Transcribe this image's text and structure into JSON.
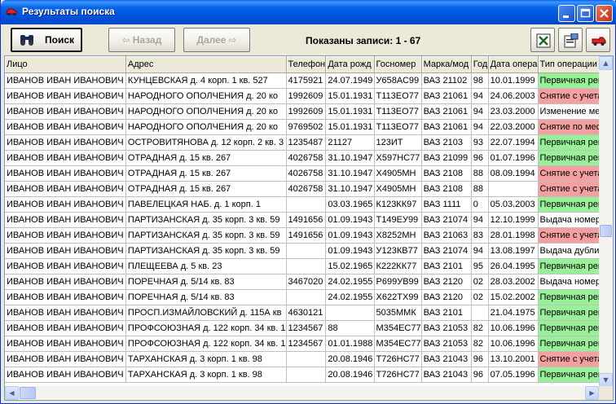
{
  "window": {
    "title": "Результаты поиска"
  },
  "toolbar": {
    "search_label": "Поиск",
    "back_label": "Назад",
    "next_label": "Далее",
    "records_text": "Показаны записи: 1 - 67"
  },
  "columns": [
    "Лицо",
    "Адрес",
    "Телефон",
    "Дата рожд",
    "Госномер",
    "Марка/мод",
    "Год",
    "Дата опера",
    "Тип операции"
  ],
  "rows": [
    {
      "c": [
        "ИВАНОВ ИВАН ИВАНОВИЧ",
        "КУНЦЕВСКАЯ д. 4 корп. 1 кв. 527",
        "4175921",
        "24.07.1949",
        "У658АС99",
        "ВАЗ 21102",
        "98",
        "10.01.1999",
        "Первичная реги"
      ],
      "op": "green"
    },
    {
      "c": [
        "ИВАНОВ ИВАН ИВАНОВИЧ",
        "НАРОДНОГО ОПОЛЧЕНИЯ д. 20 ко",
        "1992609",
        "15.01.1931",
        "Т113ЕО77",
        "ВАЗ 21061",
        "94",
        "24.06.2003",
        "Снятие с учета д"
      ],
      "op": "pink"
    },
    {
      "c": [
        "ИВАНОВ ИВАН ИВАНОВИЧ",
        "НАРОДНОГО ОПОЛЧЕНИЯ д. 20 ко",
        "1992609",
        "15.01.1931",
        "Т113ЕО77",
        "ВАЗ 21061",
        "94",
        "23.03.2000",
        "Изменение мес"
      ],
      "op": "white"
    },
    {
      "c": [
        "ИВАНОВ ИВАН ИВАНОВИЧ",
        "НАРОДНОГО ОПОЛЧЕНИЯ д. 20 ко",
        "9769502",
        "15.01.1931",
        "Т113ЕО77",
        "ВАЗ 21061",
        "94",
        "22.03.2000",
        "Снятие по месту"
      ],
      "op": "pink"
    },
    {
      "c": [
        "ИВАНОВ ИВАН ИВАНОВИЧ",
        "ОСТРОВИТЯНОВА д. 12 корп. 2 кв. 3",
        "1235487",
        "21127",
        "123ИТ",
        "ВАЗ 2103",
        "93",
        "22.07.1994",
        "Первичная реги"
      ],
      "op": "green"
    },
    {
      "c": [
        "ИВАНОВ ИВАН ИВАНОВИЧ",
        "ОТРАДНАЯ д. 15 кв. 267",
        "4026758",
        "31.10.1947",
        "Х597НС77",
        "ВАЗ 21099",
        "96",
        "01.07.1996",
        "Первичная реги"
      ],
      "op": "green"
    },
    {
      "c": [
        "ИВАНОВ ИВАН ИВАНОВИЧ",
        "ОТРАДНАЯ д. 15 кв. 267",
        "4026758",
        "31.10.1947",
        "Х4905МН",
        "ВАЗ 2108",
        "88",
        "08.09.1994",
        "Снятие с учета д"
      ],
      "op": "pink"
    },
    {
      "c": [
        "ИВАНОВ ИВАН ИВАНОВИЧ",
        "ОТРАДНАЯ д. 15 кв. 267",
        "4026758",
        "31.10.1947",
        "Х4905МН",
        "ВАЗ 2108",
        "88",
        "",
        "Снятие с учета д"
      ],
      "op": "pink"
    },
    {
      "c": [
        "ИВАНОВ ИВАН ИВАНОВИЧ",
        "ПАВЕЛЕЦКАЯ НАБ. д. 1 корп. 1",
        "",
        "03.03.1965",
        "К123КК97",
        "ВАЗ 1111",
        "0",
        "05.03.2003",
        "Первичная реги"
      ],
      "op": "green"
    },
    {
      "c": [
        "ИВАНОВ ИВАН ИВАНОВИЧ",
        "ПАРТИЗАНСКАЯ д. 35 корп. 3 кв. 59",
        "1491656",
        "01.09.1943",
        "Т149ЕУ99",
        "ВАЗ 21074",
        "94",
        "12.10.1999",
        "Выдача номерны"
      ],
      "op": "white"
    },
    {
      "c": [
        "ИВАНОВ ИВАН ИВАНОВИЧ",
        "ПАРТИЗАНСКАЯ д. 35 корп. 3 кв. 59",
        "1491656",
        "01.09.1943",
        "Х8252МН",
        "ВАЗ 21063",
        "83",
        "28.01.1998",
        "Снятие с учета д"
      ],
      "op": "pink"
    },
    {
      "c": [
        "ИВАНОВ ИВАН ИВАНОВИЧ",
        "ПАРТИЗАНСКАЯ д. 35 корп. 3 кв. 59",
        "",
        "01.09.1943",
        "У123КВ77",
        "ВАЗ 21074",
        "94",
        "13.08.1997",
        "Выдача дублика"
      ],
      "op": "white"
    },
    {
      "c": [
        "ИВАНОВ ИВАН ИВАНОВИЧ",
        "ПЛЕЩЕЕВА д. 5 кв. 23",
        "",
        "15.02.1965",
        "К222КК77",
        "ВАЗ 2101",
        "95",
        "26.04.1995",
        "Первичная реги"
      ],
      "op": "green"
    },
    {
      "c": [
        "ИВАНОВ ИВАН ИВАНОВИЧ",
        "ПОРЕЧНАЯ д. 5/14 кв. 83",
        "3467020",
        "24.02.1955",
        "Р699УВ99",
        "ВАЗ 2120",
        "02",
        "28.03.2002",
        "Выдача номерны"
      ],
      "op": "white"
    },
    {
      "c": [
        "ИВАНОВ ИВАН ИВАНОВИЧ",
        "ПОРЕЧНАЯ д. 5/14 кв. 83",
        "",
        "24.02.1955",
        "Х622ТХ99",
        "ВАЗ 2120",
        "02",
        "15.02.2002",
        "Первичная реги"
      ],
      "op": "green"
    },
    {
      "c": [
        "ИВАНОВ ИВАН ИВАНОВИЧ",
        "ПРОСП.ИЗМАЙЛОВСКИЙ д. 115А кв",
        "4630121",
        "",
        "5035ММК",
        "ВАЗ 2101",
        "",
        "21.04.1975",
        "Первичная реги"
      ],
      "op": "green"
    },
    {
      "c": [
        "ИВАНОВ ИВАН ИВАНОВИЧ",
        "ПРОФСОЮЗНАЯ д. 122 корп. 34 кв. 1",
        "1234567",
        "88",
        "М354ЕС77",
        "ВАЗ 21053",
        "82",
        "10.06.1996",
        "Первичная реги"
      ],
      "op": "green"
    },
    {
      "c": [
        "ИВАНОВ ИВАН ИВАНОВИЧ",
        "ПРОФСОЮЗНАЯ д. 122 корп. 34 кв. 1",
        "1234567",
        "01.01.1988",
        "М354ЕС77",
        "ВАЗ 21053",
        "82",
        "10.06.1996",
        "Первичная реги"
      ],
      "op": "green"
    },
    {
      "c": [
        "ИВАНОВ ИВАН ИВАНОВИЧ",
        "ТАРХАНСКАЯ д. 3 корп. 1 кв. 98",
        "",
        "20.08.1946",
        "Т726НС77",
        "ВАЗ 21043",
        "96",
        "13.10.2001",
        "Снятие с учета д"
      ],
      "op": "pink"
    },
    {
      "c": [
        "ИВАНОВ ИВАН ИВАНОВИЧ",
        "ТАРХАНСКАЯ д. 3 корп. 1 кв. 98",
        "",
        "20.08.1946",
        "Т726НС77",
        "ВАЗ 21043",
        "96",
        "07.05.1996",
        "Первичная реги"
      ],
      "op": "green"
    }
  ],
  "colors": {
    "titlebar": "#0055e0",
    "op_green": "#98f098",
    "op_pink": "#f4a0a0"
  }
}
